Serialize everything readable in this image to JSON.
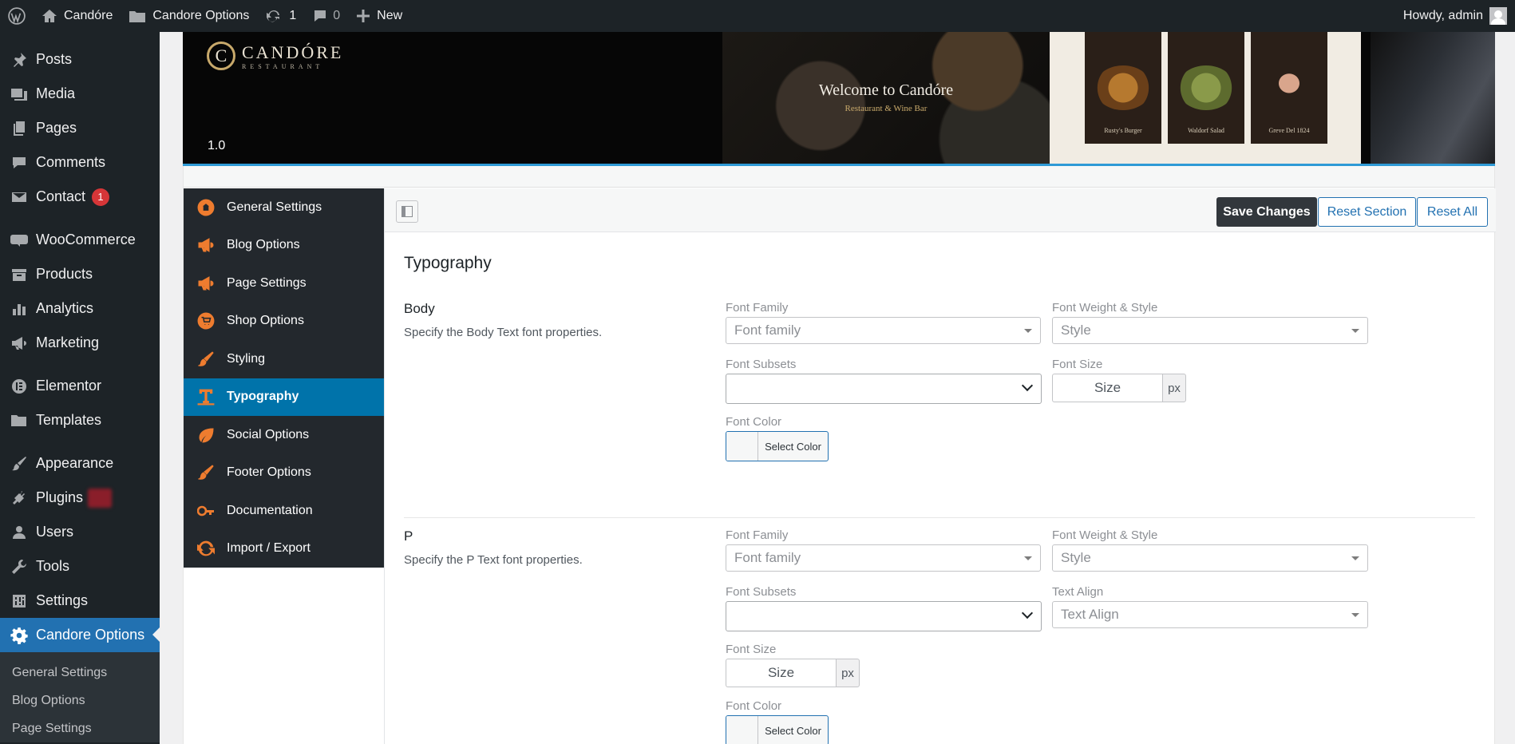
{
  "admin_bar": {
    "site_name": "Candóre",
    "options_label": "Candore Options",
    "updates_count": "1",
    "comments_count": "0",
    "new_label": "New",
    "greeting": "Howdy, admin"
  },
  "sidebar": {
    "items": [
      {
        "label": "Posts",
        "icon": "pushpin-icon"
      },
      {
        "label": "Media",
        "icon": "media-icon"
      },
      {
        "label": "Pages",
        "icon": "pages-icon"
      },
      {
        "label": "Comments",
        "icon": "comment-icon"
      },
      {
        "label": "Contact",
        "icon": "mail-icon",
        "badge": "1"
      },
      {
        "label": "WooCommerce",
        "icon": "woo-icon"
      },
      {
        "label": "Products",
        "icon": "archive-icon"
      },
      {
        "label": "Analytics",
        "icon": "bar-chart-icon"
      },
      {
        "label": "Marketing",
        "icon": "megaphone-icon"
      },
      {
        "label": "Elementor",
        "icon": "elementor-icon"
      },
      {
        "label": "Templates",
        "icon": "folder-icon"
      },
      {
        "label": "Appearance",
        "icon": "brush-icon"
      },
      {
        "label": "Plugins",
        "icon": "plug-icon"
      },
      {
        "label": "Users",
        "icon": "user-icon"
      },
      {
        "label": "Tools",
        "icon": "wrench-icon"
      },
      {
        "label": "Settings",
        "icon": "sliders-icon"
      },
      {
        "label": "Candore Options",
        "icon": "gear-icon"
      }
    ],
    "submenu": [
      "General Settings",
      "Blog Options",
      "Page Settings"
    ]
  },
  "banner": {
    "logo_name": "CANDÓRE",
    "logo_sub": "RESTAURANT",
    "version": "1.0",
    "welcome_title": "Welcome to Candóre",
    "welcome_sub": "Restaurant & Wine Bar",
    "dishes": [
      "Rusty's Burger",
      "Waldorf Salad",
      "Greve Del 1824"
    ]
  },
  "tabs": [
    {
      "label": "General Settings",
      "icon": "home-icon"
    },
    {
      "label": "Blog Options",
      "icon": "megaphone-icon"
    },
    {
      "label": "Page Settings",
      "icon": "megaphone-icon"
    },
    {
      "label": "Shop Options",
      "icon": "cart-icon"
    },
    {
      "label": "Styling",
      "icon": "brush-icon"
    },
    {
      "label": "Typography",
      "icon": "text-icon",
      "active": true
    },
    {
      "label": "Social Options",
      "icon": "leaf-icon"
    },
    {
      "label": "Footer Options",
      "icon": "brush-icon"
    },
    {
      "label": "Documentation",
      "icon": "key-icon"
    },
    {
      "label": "Import / Export",
      "icon": "refresh-icon"
    }
  ],
  "toolbar": {
    "save": "Save Changes",
    "reset_section": "Reset Section",
    "reset_all": "Reset All"
  },
  "section_title": "Typography",
  "fields": {
    "font_family": "Font Family",
    "font_family_ph": "Font family",
    "font_weight": "Font Weight & Style",
    "font_weight_ph": "Style",
    "font_subsets": "Font Subsets",
    "font_size": "Font Size",
    "size_ph": "Size",
    "unit": "px",
    "font_color": "Font Color",
    "select_color": "Select Color",
    "text_align": "Text Align",
    "text_align_ph": "Text Align"
  },
  "rows": {
    "body": {
      "title": "Body",
      "desc": "Specify the Body Text font properties."
    },
    "p": {
      "title": "P",
      "desc": "Specify the P Text font properties."
    }
  },
  "colors": {
    "accent": "#2271b1",
    "tab_active": "#0073aa",
    "tab_icon": "#ee7c2f",
    "sidebar_bg": "#1d2327",
    "badge": "#d63638"
  }
}
